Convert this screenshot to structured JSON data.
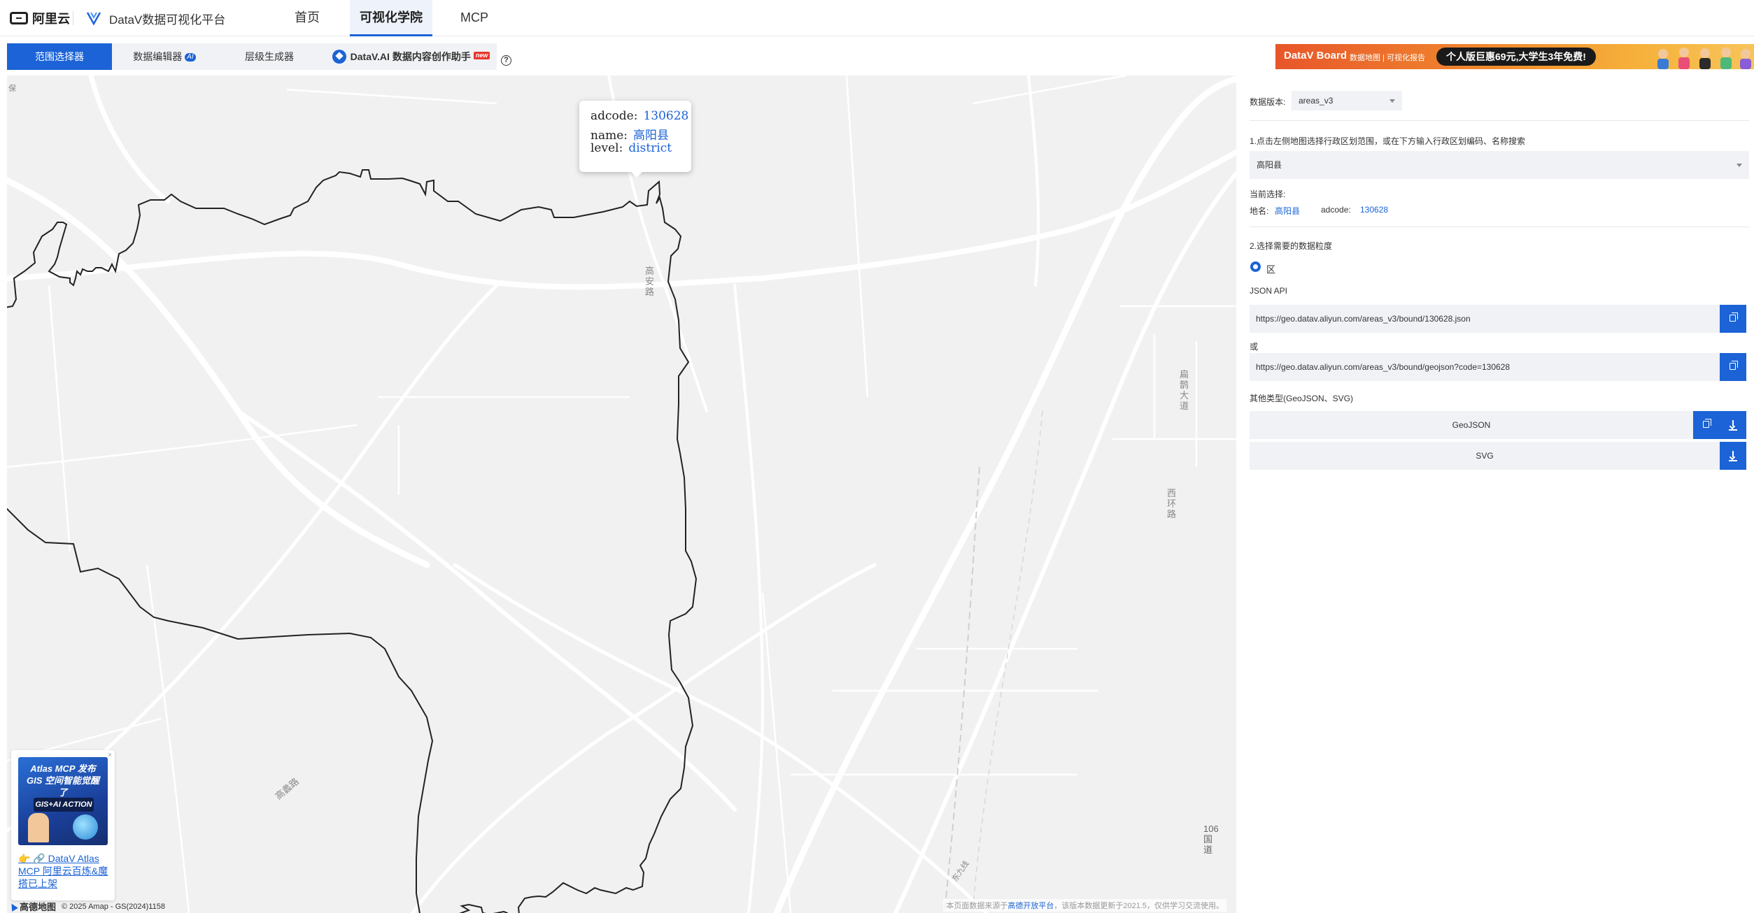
{
  "header": {
    "logo_text": "阿里云",
    "brand": "DataV数据可视化平台",
    "nav": [
      "首页",
      "可视化学院",
      "MCP"
    ]
  },
  "tools": {
    "tabs": [
      "范围选择器",
      "数据编辑器",
      "层级生成器",
      "DataV.AI 数据内容创作助手"
    ],
    "ai_badge": "AI",
    "new_badge": "new",
    "help": "?"
  },
  "banner": {
    "title": "DataV Board",
    "subtitle": "数据地图 | 可视化报告",
    "promo": "个人版巨惠69元,大学生3年免费!"
  },
  "map": {
    "tooltip": {
      "adcode_label": "adcode:",
      "adcode": "130628",
      "name_label": "name:",
      "name": "高阳县",
      "level_label": "level:",
      "level": "district"
    },
    "labels": {
      "road1": "高安路",
      "road2": "扁鹊大道",
      "road3": "西环路",
      "road4": "高蠡路",
      "road5": "东九线",
      "road6": "106国道",
      "top_left": "保"
    },
    "promo": {
      "title": "Atlas MCP 发布 GIS 空间智能觉醒了",
      "badge": "GIS+AI ACTION",
      "link": "👉 🔗 DataV Atlas MCP 阿里云百炼&魔搭已上架",
      "close": "×"
    },
    "amap_brand": "高德地图",
    "amap_copyright": "© 2025 Amap - GS(2024)1158",
    "attribution_pre": "本页面数据来源于",
    "attribution_link": "高德开放平台",
    "attribution_post": "，该版本数据更新于2021.5，仅供学习交流使用。"
  },
  "panel": {
    "version_label": "数据版本:",
    "version_value": "areas_v3",
    "step1": "1.点击左侧地图选择行政区划范围，或在下方输入行政区划编码、名称搜索",
    "search_value": "高阳县",
    "current_label": "当前选择:",
    "place_label": "地名:",
    "place_value": "高阳县",
    "adcode_label": "adcode:",
    "adcode_value": "130628",
    "step2": "2.选择需要的数据粒度",
    "granularity": "区",
    "json_api_label": "JSON API",
    "json_api_url": "https://geo.datav.aliyun.com/areas_v3/bound/130628.json",
    "or_label": "或",
    "geojson_url": "https://geo.datav.aliyun.com/areas_v3/bound/geojson?code=130628",
    "other_label": "其他类型(GeoJSON、SVG)",
    "geojson_btn": "GeoJSON",
    "svg_btn": "SVG"
  }
}
